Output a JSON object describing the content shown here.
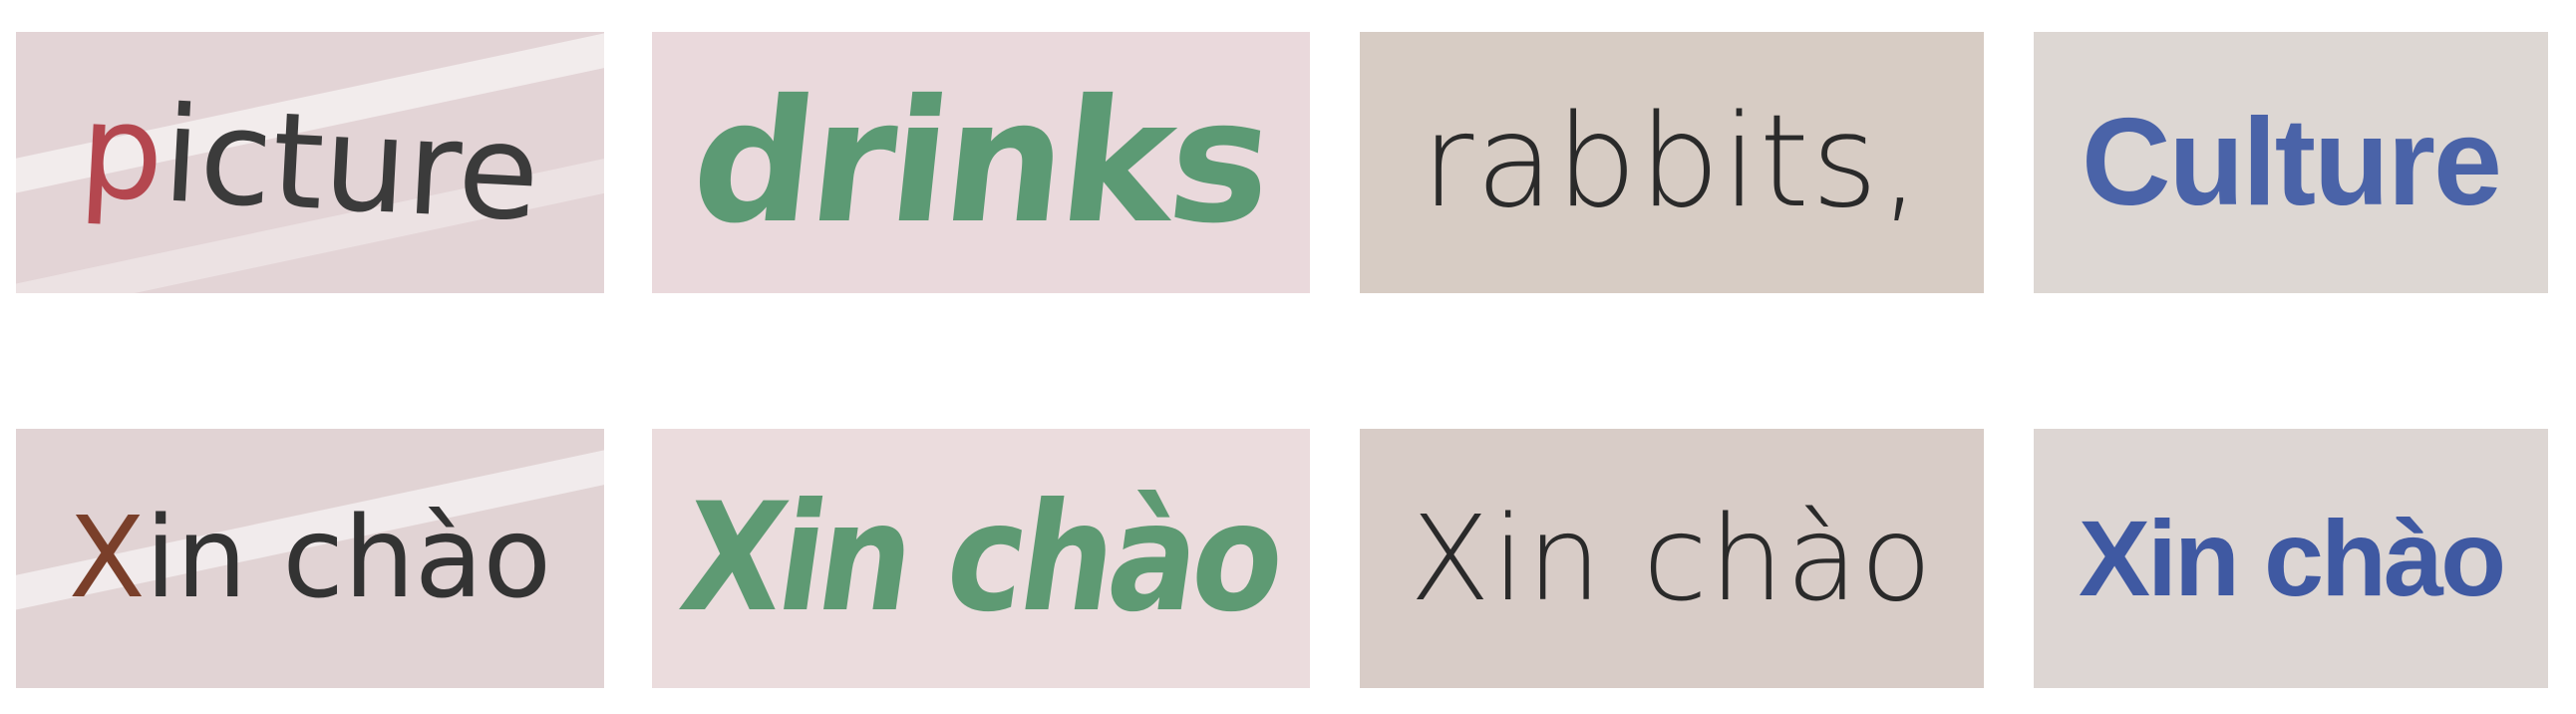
{
  "tiles": [
    {
      "id": "picture",
      "text": "picture",
      "color": "#3b3b3b",
      "accent": "#b4474f",
      "bg": "#e3d4d6"
    },
    {
      "id": "drinks",
      "text": "drinks",
      "color": "#5c9a74",
      "bg": "#ead9dc"
    },
    {
      "id": "rabbits",
      "text": "rabbits,",
      "color": "#2a2a2a",
      "bg": "#d7ccc4"
    },
    {
      "id": "culture",
      "text": "Culture",
      "color": "#4a63a8",
      "bg": "#ddd7d3"
    },
    {
      "id": "xin-chao-1",
      "text": "Xin chào",
      "color": "#333333",
      "accent": "#7a3f2a",
      "bg": "#e1d3d4"
    },
    {
      "id": "xin-chao-2",
      "text": "Xin chào",
      "color": "#5e9a73",
      "bg": "#ebdcdd"
    },
    {
      "id": "xin-chao-3",
      "text": "Xin chào",
      "color": "#2a2a2a",
      "bg": "#d8ccc7"
    },
    {
      "id": "xin-chao-4",
      "text": "Xin chào",
      "color": "#3f59a2",
      "bg": "#ddd6d3"
    }
  ],
  "words": {
    "picture_first": "p",
    "picture_rest": "icture",
    "drinks": "drinks",
    "rabbits": "rabbits,",
    "culture": "Culture",
    "xin1_first": "X",
    "xin1_rest": "in chào",
    "xin2": "Xin chào",
    "xin3": "Xin chào",
    "xin4": "Xin chào"
  }
}
